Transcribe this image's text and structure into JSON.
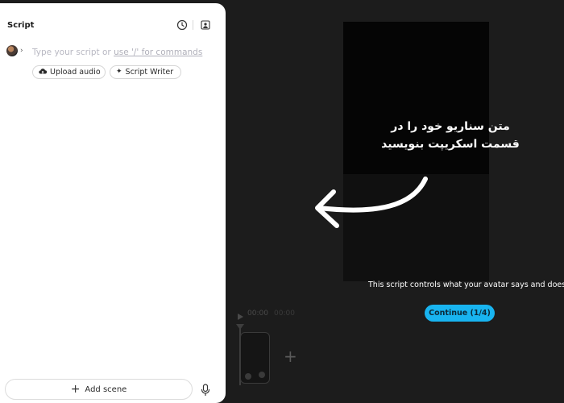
{
  "script_panel": {
    "title": "Script",
    "input_placeholder_prefix": "Type your script or ",
    "input_placeholder_link": "use '/' for commands",
    "upload_audio_label": "Upload audio",
    "script_writer_label": "Script Writer",
    "add_scene_label": "Add scene",
    "icons": [
      "history-icon",
      "avatar-library-icon",
      "upload-cloud-icon",
      "sparkle-icon",
      "plus-icon",
      "microphone-icon"
    ]
  },
  "timeline": {
    "current_time": "00:00",
    "duration": "00:00"
  },
  "onboarding": {
    "tip_line1": "متن سناریو خود را در",
    "tip_line2": "قسمت اسکریپت  بنویسید",
    "description": "This script controls what your avatar says and does.",
    "continue_label": "Continue (1/4)",
    "accent_color": "#18b4f0"
  }
}
